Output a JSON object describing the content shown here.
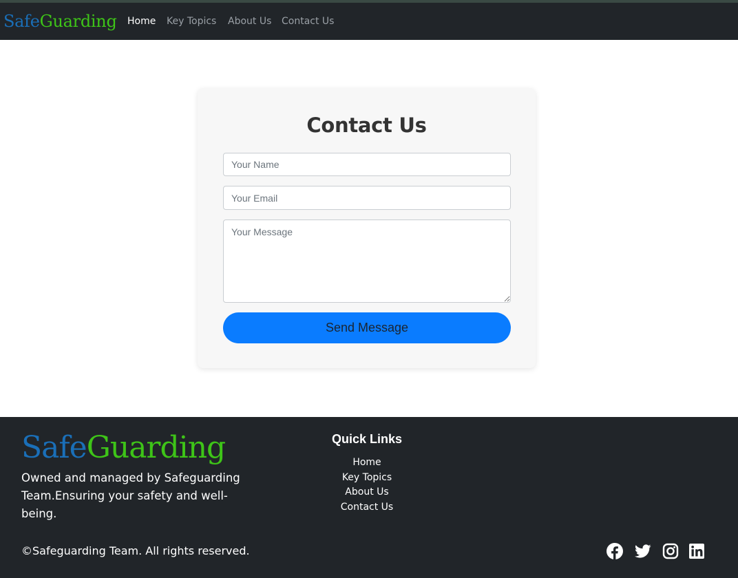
{
  "navbar": {
    "brand_part1": "Safe",
    "brand_part2": "Guarding",
    "links": [
      {
        "label": "Home",
        "active": true
      },
      {
        "label": "Key Topics",
        "active": false
      },
      {
        "label": "About Us",
        "active": false
      },
      {
        "label": "Contact Us",
        "active": false
      }
    ]
  },
  "contact_form": {
    "title": "Contact Us",
    "name_placeholder": "Your Name",
    "email_placeholder": "Your Email",
    "message_placeholder": "Your Message",
    "name_value": "",
    "email_value": "",
    "message_value": "",
    "submit_label": "Send Message"
  },
  "footer": {
    "brand_part1": "Safe",
    "brand_part2": "Guarding",
    "description": "Owned and managed by Safeguarding Team.Ensuring your safety and well-being.",
    "quick_links_title": "Quick Links",
    "quick_links": [
      "Home",
      "Key Topics",
      "About Us",
      "Contact Us"
    ],
    "copyright": "©Safeguarding Team. All rights reserved.",
    "social_icons": [
      "facebook-icon",
      "twitter-icon",
      "instagram-icon",
      "linkedin-icon"
    ]
  },
  "colors": {
    "brand_blue": "#1a6fb8",
    "brand_green": "#3ec418",
    "dark_bg": "#212529",
    "button_blue": "#0a7cff"
  }
}
